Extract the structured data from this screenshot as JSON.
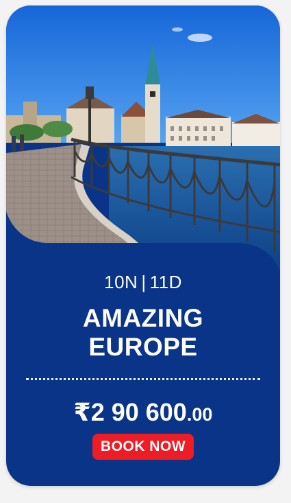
{
  "package": {
    "nights": "10N",
    "separator": "|",
    "days": "11D",
    "title_line1": "AMAZING",
    "title_line2": "EUROPE",
    "price_symbol": "₹",
    "price_main": "2 90 600",
    "price_decimal": ".00",
    "book_label": "BOOK NOW"
  },
  "colors": {
    "card_bg": "#0a3487",
    "button_bg": "#ee1c25",
    "text": "#ffffff"
  }
}
